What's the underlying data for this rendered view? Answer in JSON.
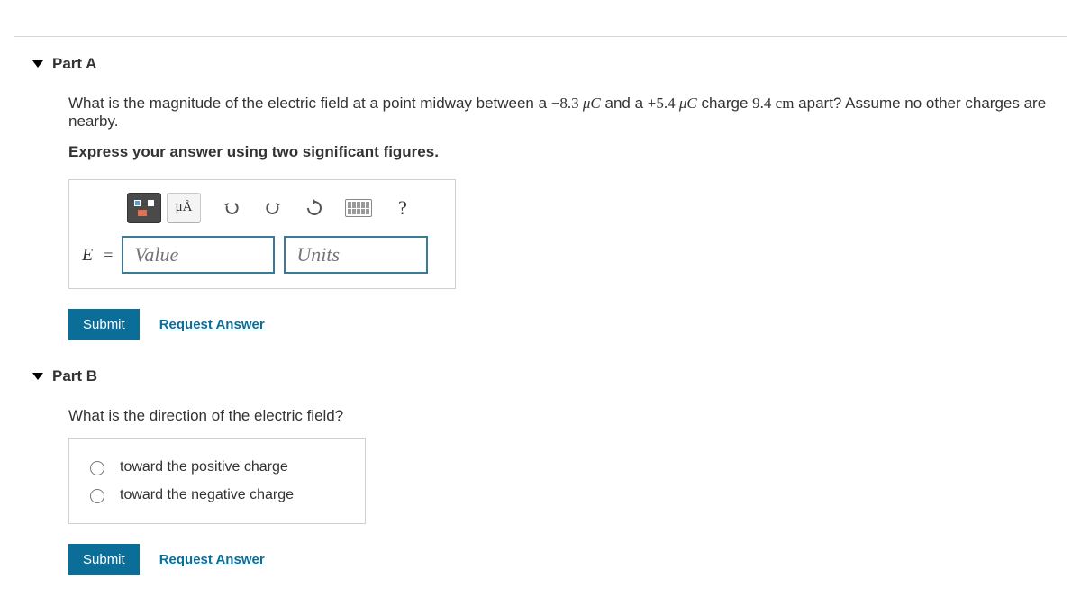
{
  "partA": {
    "title": "Part A",
    "question_prefix": "What is the magnitude of the electric field at a point midway between a ",
    "q_val1": "−8.3 ",
    "q_unit1": "μC",
    "q_mid": " and a ",
    "q_val2": "+5.4 ",
    "q_unit2": "μC",
    "q_mid2": " charge ",
    "q_val3": "9.4 cm",
    "q_suffix": " apart? Assume no other charges are nearby.",
    "instruction": "Express your answer using two significant figures.",
    "toolbar": {
      "special_chars": "μÅ",
      "help": "?"
    },
    "var_label": "E",
    "equals": "=",
    "value_placeholder": "Value",
    "units_placeholder": "Units",
    "submit": "Submit",
    "request": "Request Answer"
  },
  "partB": {
    "title": "Part B",
    "question": "What is the direction of the electric field?",
    "option1": "toward the positive charge",
    "option2": "toward the negative charge",
    "submit": "Submit",
    "request": "Request Answer"
  }
}
